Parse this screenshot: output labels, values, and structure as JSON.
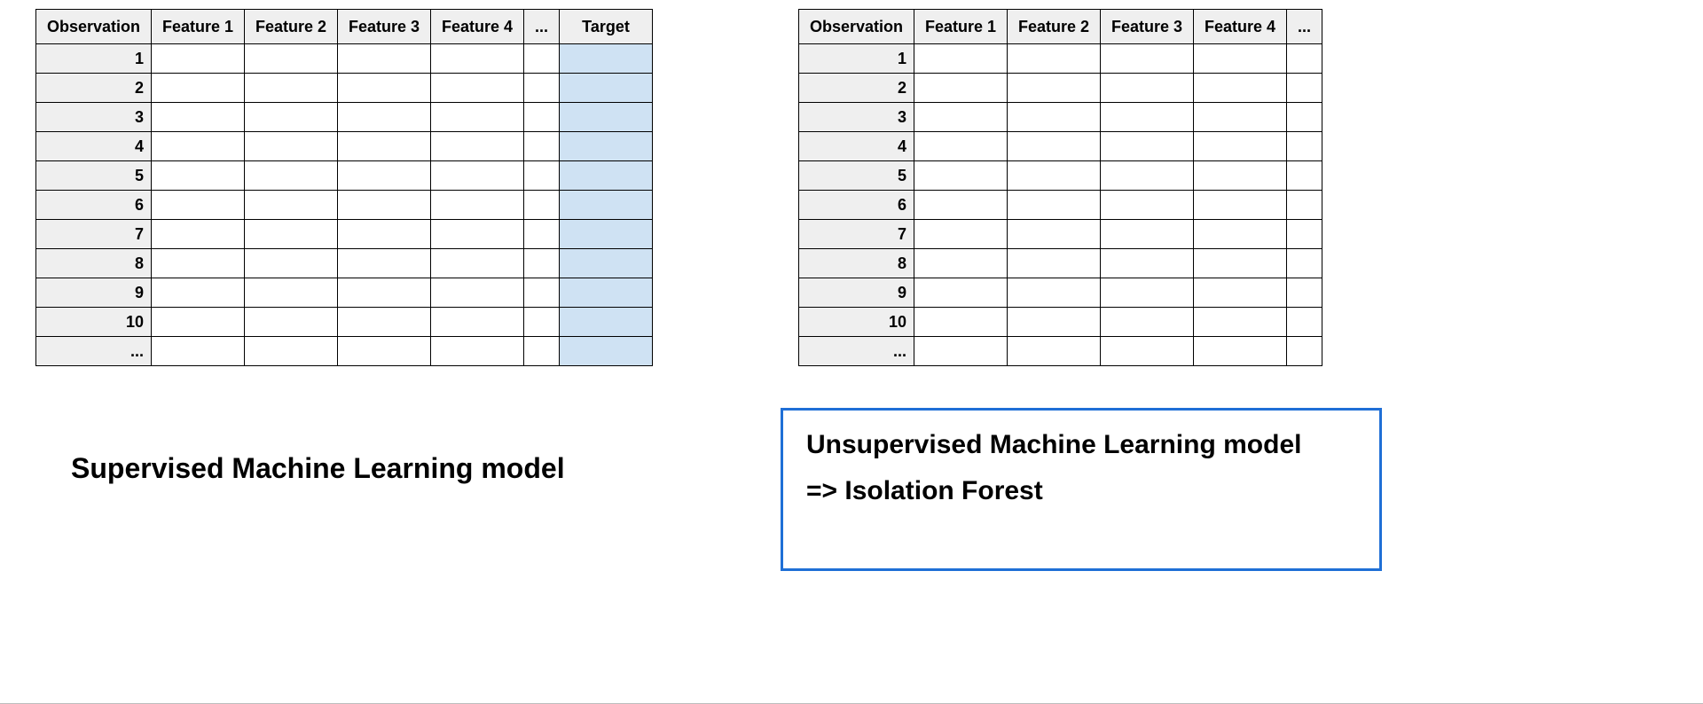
{
  "left_table": {
    "headers": [
      "Observation",
      "Feature 1",
      "Feature 2",
      "Feature 3",
      "Feature 4",
      "...",
      "Target"
    ],
    "observation_labels": [
      "1",
      "2",
      "3",
      "4",
      "5",
      "6",
      "7",
      "8",
      "9",
      "10",
      "..."
    ],
    "target_column_highlight": "#cfe2f3"
  },
  "right_table": {
    "headers": [
      "Observation",
      "Feature 1",
      "Feature 2",
      "Feature 3",
      "Feature 4",
      "..."
    ],
    "observation_labels": [
      "1",
      "2",
      "3",
      "4",
      "5",
      "6",
      "7",
      "8",
      "9",
      "10",
      "..."
    ]
  },
  "captions": {
    "left": "Supervised Machine Learning model",
    "right_line1": "Unsupervised Machine Learning model",
    "right_line2": "=> Isolation Forest"
  },
  "chart_data": [
    {
      "type": "table",
      "title": "Supervised Machine Learning model",
      "columns": [
        "Observation",
        "Feature 1",
        "Feature 2",
        "Feature 3",
        "Feature 4",
        "...",
        "Target"
      ],
      "rows": [
        {
          "Observation": "1"
        },
        {
          "Observation": "2"
        },
        {
          "Observation": "3"
        },
        {
          "Observation": "4"
        },
        {
          "Observation": "5"
        },
        {
          "Observation": "6"
        },
        {
          "Observation": "7"
        },
        {
          "Observation": "8"
        },
        {
          "Observation": "9"
        },
        {
          "Observation": "10"
        },
        {
          "Observation": "..."
        }
      ],
      "note": "Feature and Target cells are blank in the image; Target column is highlighted light blue."
    },
    {
      "type": "table",
      "title": "Unsupervised Machine Learning model => Isolation Forest",
      "columns": [
        "Observation",
        "Feature 1",
        "Feature 2",
        "Feature 3",
        "Feature 4",
        "..."
      ],
      "rows": [
        {
          "Observation": "1"
        },
        {
          "Observation": "2"
        },
        {
          "Observation": "3"
        },
        {
          "Observation": "4"
        },
        {
          "Observation": "5"
        },
        {
          "Observation": "6"
        },
        {
          "Observation": "7"
        },
        {
          "Observation": "8"
        },
        {
          "Observation": "9"
        },
        {
          "Observation": "10"
        },
        {
          "Observation": "..."
        }
      ],
      "note": "No Target column (unsupervised)."
    }
  ]
}
